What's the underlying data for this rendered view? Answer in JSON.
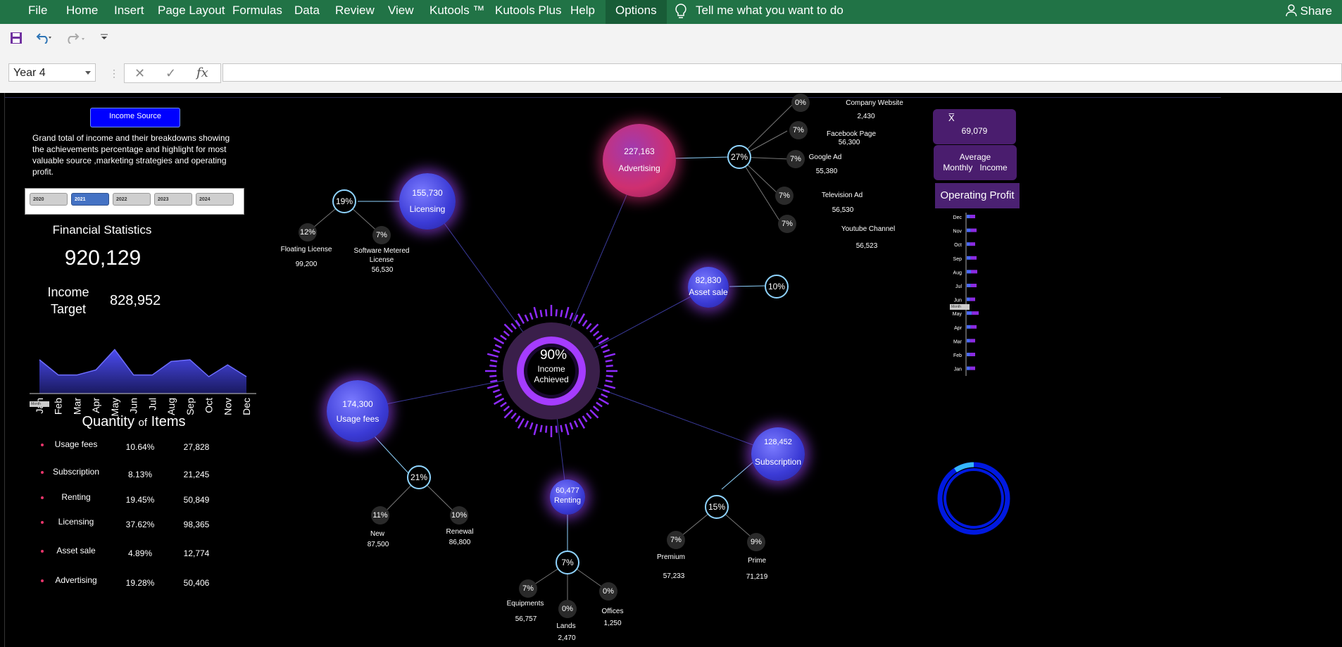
{
  "ribbon": {
    "tabs": [
      "File",
      "Home",
      "Insert",
      "Page Layout",
      "Formulas",
      "Data",
      "Review",
      "View",
      "Kutools ™",
      "Kutools Plus",
      "Help",
      "Options"
    ],
    "tell_me": "Tell me what you want to do",
    "share": "Share"
  },
  "formula_bar": {
    "name_box": "Year 4",
    "formula": ""
  },
  "dashboard": {
    "income_source_button": "Income Source",
    "description": [
      "Grand total of income and their breakdowns showing",
      "the achievements percentage and highlight for most",
      "valuable source ,marketing strategies and operating",
      "profit."
    ],
    "years": [
      "2020",
      "2021",
      "2022",
      "2023",
      "2024"
    ],
    "financial_title": "Financial Statistics",
    "total": "920,129",
    "income_target_label1": "Income",
    "income_target_label2": "Target",
    "income_target_value": "828,952",
    "month_button": "Month",
    "qty_title_big": "Quantity",
    "qty_title_of": "of",
    "qty_title_items": "Items",
    "quantity": [
      {
        "name": "Usage fees",
        "pct": "10.64%",
        "value": "27,828"
      },
      {
        "name": "Subscription",
        "pct": "8.13%",
        "value": "21,245"
      },
      {
        "name": "Renting",
        "pct": "19.45%",
        "value": "50,849"
      },
      {
        "name": "Licensing",
        "pct": "37.62%",
        "value": "98,365"
      },
      {
        "name": "Asset sale",
        "pct": "4.89%",
        "value": "12,774"
      },
      {
        "name": "Advertising",
        "pct": "19.28%",
        "value": "50,406"
      }
    ],
    "center": {
      "pct": "90%",
      "l1": "Income",
      "l2": "Achieved"
    },
    "licensing": {
      "value": "155,730",
      "label": "Licensing",
      "pct": "19%",
      "children": [
        {
          "pct": "12%",
          "name": "Floating License",
          "value": "99,200"
        },
        {
          "pct": "7%",
          "name1": "Software Metered",
          "name2": "License",
          "value": "56,530"
        }
      ]
    },
    "advertising": {
      "value": "227,163",
      "label": "Advertising",
      "pct": "27%",
      "children": [
        {
          "pct": "0%",
          "name": "Company Website",
          "value": "2,430"
        },
        {
          "pct": "7%",
          "name": "Facebook Page",
          "value": "56,300"
        },
        {
          "pct": "7%",
          "name": "Google Ad",
          "value": "55,380"
        },
        {
          "pct": "7%",
          "name": "Television Ad",
          "value": "56,530"
        },
        {
          "pct": "7%",
          "name": "Youtube Channel",
          "value": "56,523"
        }
      ]
    },
    "asset_sale": {
      "value": "82,830",
      "label": "Asset sale",
      "pct": "10%"
    },
    "usage_fees": {
      "value": "174,300",
      "label": "Usage fees",
      "pct": "21%",
      "children": [
        {
          "pct": "11%",
          "name": "New",
          "value": "87,500"
        },
        {
          "pct": "10%",
          "name": "Renewal",
          "value": "86,800"
        }
      ]
    },
    "renting": {
      "value": "60,477",
      "label": "Renting",
      "pct": "7%",
      "children": [
        {
          "pct": "7%",
          "name": "Equipments",
          "value": "56,757"
        },
        {
          "pct": "0%",
          "name": "Lands",
          "value": "2,470"
        },
        {
          "pct": "0%",
          "name": "Offices",
          "value": "1,250"
        }
      ]
    },
    "subscription": {
      "value": "128,452",
      "label": "Subscription",
      "pct": "15%",
      "children": [
        {
          "pct": "7%",
          "name": "Premium",
          "value": "57,233"
        },
        {
          "pct": "9%",
          "name": "Prime",
          "value": "71,219"
        }
      ]
    },
    "mean_symbol": "X̅",
    "mean_value": "69,079",
    "avg_label1": "Average",
    "avg_label2": "Monthly   Income",
    "operating_profit": "Operating Profit",
    "op_months": [
      "Dec",
      "Nov",
      "Oct",
      "Sep",
      "Aug",
      "Jul",
      "Jun",
      "May",
      "Apr",
      "Mar",
      "Feb",
      "Jan"
    ],
    "op_month_button": "Month"
  },
  "chart_data": {
    "type": "area",
    "categories": [
      "Jan",
      "Feb",
      "Mar",
      "Apr",
      "May",
      "Jun",
      "Jul",
      "Aug",
      "Sep",
      "Oct",
      "Nov",
      "Dec"
    ],
    "values": [
      40,
      22,
      22,
      28,
      52,
      22,
      22,
      38,
      40,
      20,
      34,
      20
    ],
    "title": "",
    "xlabel": "",
    "ylabel": ""
  },
  "colors": {
    "ribbon": "#217346",
    "bubble": "#4b4be0",
    "advertising": "#d6336c",
    "accent": "#8f2bff",
    "dot": "#e8356b"
  }
}
